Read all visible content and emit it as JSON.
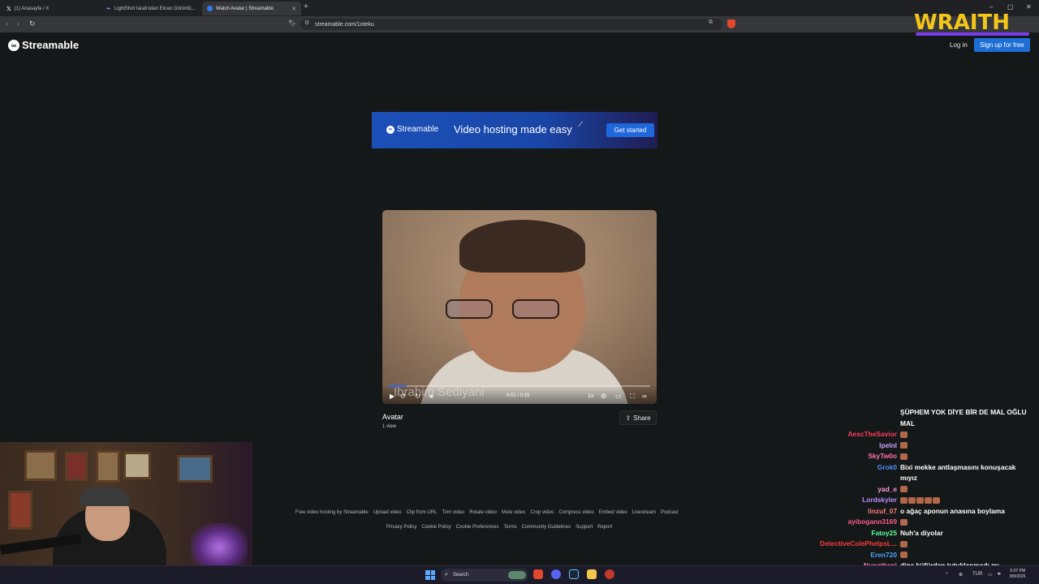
{
  "browser": {
    "tabs": [
      {
        "label": "(1) Anasayfa / X",
        "icon": "x-logo-icon"
      },
      {
        "label": "LightShot tarafından Ekran Görüntü...",
        "icon": "lightshot-feather-icon"
      },
      {
        "label": "Watch Avatar | Streamable",
        "icon": "streamable-icon"
      }
    ],
    "new_tab": "+",
    "url": "streamable.com/1oteku"
  },
  "site": {
    "logo_text": "Streamable",
    "login": "Log in",
    "signup": "Sign up for free"
  },
  "banner": {
    "logo_text": "Streamable",
    "headline": "Video hosting made easy",
    "cta": "Get started"
  },
  "video": {
    "caption": "İbrahim Sediyani",
    "time": "0:01 / 0:15",
    "progress": 0.067,
    "rate": "1x",
    "title": "Avatar",
    "views": "1 view",
    "share": "Share"
  },
  "footer": {
    "row1": [
      "Free video hosting by Streamable",
      "Upload video",
      "Clip from URL",
      "Trim video",
      "Rotate video",
      "Mute video",
      "Crop video",
      "Compress video",
      "Embed video",
      "Livestream",
      "Podcast"
    ],
    "row2": [
      "Privacy Policy",
      "Cookie Policy",
      "Cookie Preferences",
      "Terms",
      "Community Guidelines",
      "Support",
      "Report"
    ]
  },
  "overlay": {
    "brand": "WRAITH"
  },
  "chat": [
    {
      "user": "",
      "color": "#ffffff",
      "msg": "ŞÜPHEM YOK DİYE BİR DE MAL OĞLU",
      "emotes": 0
    },
    {
      "user": "",
      "color": "#ffffff",
      "msg": "MAL",
      "emotes": 0
    },
    {
      "user": "AescTheSavior",
      "color": "#ff3d5a",
      "msg": "",
      "emotes": 1
    },
    {
      "user": "Ipelnl",
      "color": "#c9a2ff",
      "msg": "",
      "emotes": 1
    },
    {
      "user": "SkyTw0o",
      "color": "#ff6fb0",
      "msg": "",
      "emotes": 1
    },
    {
      "user": "Grok0",
      "color": "#4d8cff",
      "msg": "Bixi mekke antlaşmasını konuşacak",
      "emotes": 0
    },
    {
      "user": "",
      "color": "#ffffff",
      "msg": "mıyız",
      "emotes": 0
    },
    {
      "user": "yad_e",
      "color": "#ff9ad5",
      "msg": "",
      "emotes": 1
    },
    {
      "user": "Lordskyler",
      "color": "#b98cff",
      "msg": "",
      "emotes": 5
    },
    {
      "user": "linzuf_07",
      "color": "#ff7b7b",
      "msg": "o ağaç aponun anasına boylama",
      "emotes": 0
    },
    {
      "user": "ayibogann3169",
      "color": "#ff5c8a",
      "msg": "",
      "emotes": 1
    },
    {
      "user": "Fatoy25",
      "color": "#5eff9a",
      "msg": "Nuh'a diyolar",
      "emotes": 0
    },
    {
      "user": "DetectiveColePhelpsL...",
      "color": "#ff3b3b",
      "msg": "",
      "emotes": 1
    },
    {
      "user": "Eren720",
      "color": "#4da3ff",
      "msg": "",
      "emotes": 1
    },
    {
      "user": "Nunathani",
      "color": "#ff7acb",
      "msg": "dine küfürden tutuklanmadı mı",
      "emotes": 0
    }
  ],
  "taskbar": {
    "search": "Search",
    "lang": "TUR",
    "time": "5:07 PM",
    "date": "8/9/2026"
  }
}
